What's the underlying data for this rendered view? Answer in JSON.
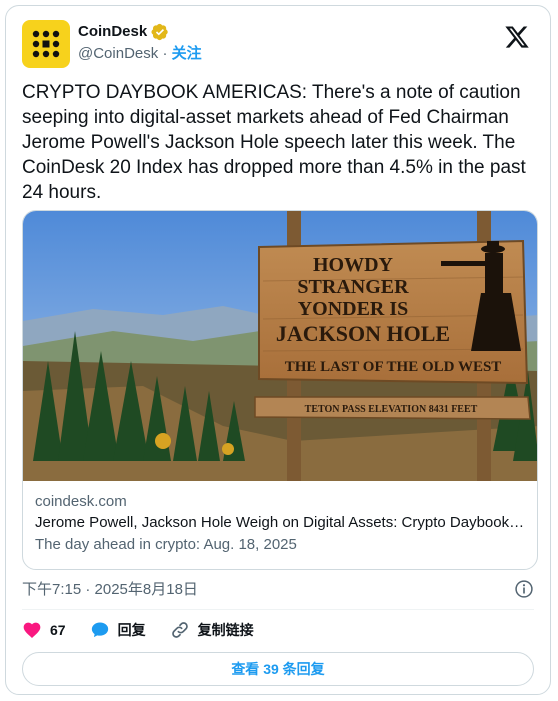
{
  "account": {
    "display_name": "CoinDesk",
    "handle": "@CoinDesk",
    "separator": "·",
    "follow_label": "关注",
    "brand_color": "#f7d21c"
  },
  "tweet": {
    "text": "CRYPTO DAYBOOK AMERICAS: There's a note of caution seeping into digital-asset markets ahead of Fed Chairman Jerome Powell's Jackson Hole speech later this week. The CoinDesk 20 Index has dropped more than 4.5% in the past 24 hours."
  },
  "link_card": {
    "image": {
      "sign_line1": "HOWDY",
      "sign_line2": "STRANGER",
      "sign_line3": "YONDER IS",
      "sign_line4": "JACKSON HOLE",
      "sign_line5": "THE LAST OF THE OLD WEST",
      "sub_sign": "TETON PASS ELEVATION 8431 FEET"
    },
    "domain": "coindesk.com",
    "title": "Jerome Powell, Jackson Hole Weigh on Digital Assets: Crypto Daybook Americas",
    "description": "The day ahead in crypto: Aug. 18, 2025"
  },
  "meta": {
    "timestamp": "下午7:15 · 2025年8月18日"
  },
  "actions": {
    "likes_count": "67",
    "reply_label": "回复",
    "copy_link_label": "复制链接",
    "like_color": "#f91880",
    "reply_color": "#1d9bf0"
  },
  "replies_button": {
    "label": "查看 39 条回复"
  }
}
